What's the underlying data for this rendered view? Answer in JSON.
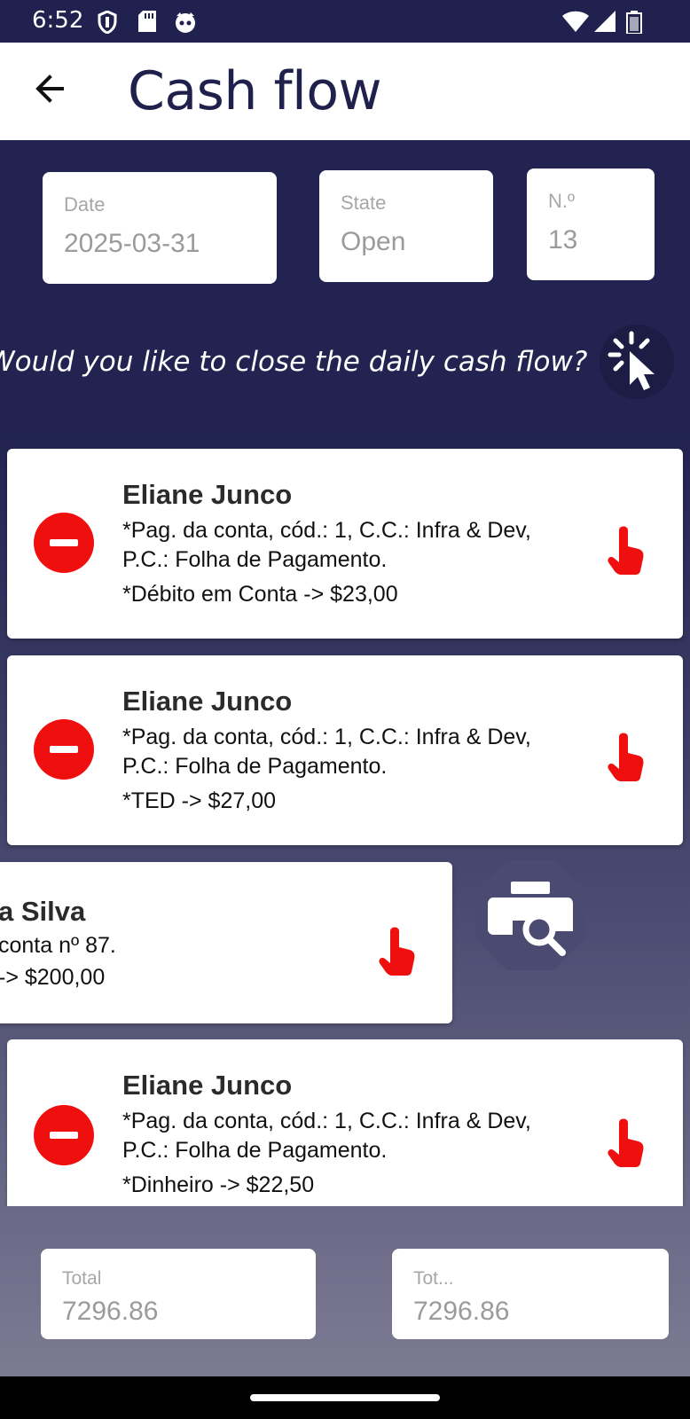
{
  "status_bar": {
    "time": "6:52"
  },
  "appbar": {
    "title": "Cash flow"
  },
  "header_fields": {
    "date": {
      "label": "Date",
      "value": "2025-03-31"
    },
    "state": {
      "label": "State",
      "value": "Open"
    },
    "number": {
      "label": "N.º",
      "value": "13"
    }
  },
  "question": "Would you like to close the daily cash flow?",
  "entries": [
    {
      "name": "Eliane Junco",
      "description": "*Pag. da conta, cód.: 1, C.C.: Infra & Dev, P.C.: Folha de Pagamento.",
      "payment": "*Débito em Conta ->  $23,00"
    },
    {
      "name": "Eliane Junco",
      "description": "*Pag. da conta, cód.: 1, C.C.: Infra & Dev, P.C.: Folha de Pagamento.",
      "payment": "*TED ->  $27,00"
    },
    {
      "name": "a Silva",
      "description": "conta nº 87.",
      "payment": "->  $200,00"
    },
    {
      "name": "Eliane Junco",
      "description": "*Pag. da conta, cód.: 1, C.C.: Infra & Dev, P.C.: Folha de Pagamento.",
      "payment": "*Dinheiro ->  $22,50"
    }
  ],
  "totals": {
    "total": {
      "label": "Total",
      "value": "7296.86"
    },
    "total2": {
      "label": "Tot...",
      "value": "7296.86"
    }
  },
  "colors": {
    "primary": "#222350",
    "accent_red": "#f00f0f",
    "card": "#ffffff"
  },
  "icons": {
    "back": "arrow-left-icon",
    "close_cash_flow": "pointer-click-icon",
    "entry_action": "hand-pointer-icon",
    "remove": "minus-circle-icon",
    "print_preview": "print-preview-icon"
  }
}
